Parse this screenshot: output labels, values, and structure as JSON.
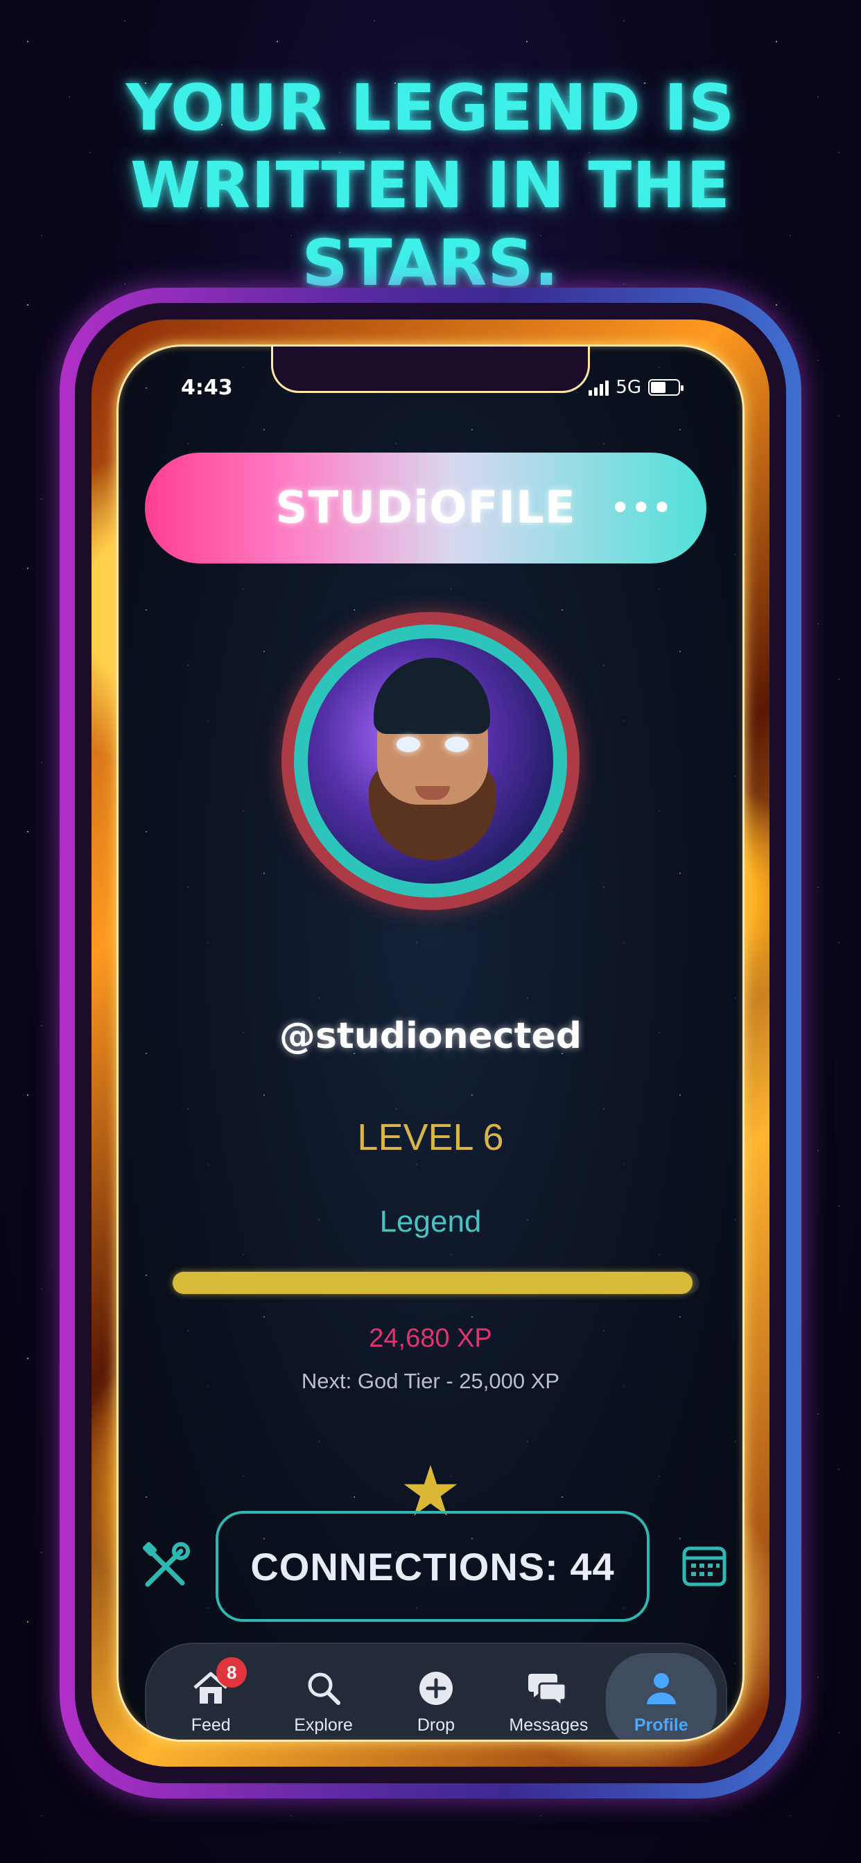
{
  "headline": "YOUR LEGEND IS WRITTEN IN THE STARS.",
  "status_bar": {
    "time": "4:43",
    "network": "5G"
  },
  "header": {
    "title": "STUDiOFILE",
    "more_label": "•••"
  },
  "profile": {
    "username": "@studionected",
    "level": "LEVEL 6",
    "rank": "Legend",
    "xp": "24,680 XP",
    "next_tier": "Next: God Tier - 25,000 XP",
    "xp_progress": 0.987,
    "connections": "CONNECTIONS: 44"
  },
  "tabs": [
    {
      "label": "Feed",
      "icon": "home-icon",
      "badge": "8",
      "active": false
    },
    {
      "label": "Explore",
      "icon": "search-icon",
      "active": false
    },
    {
      "label": "Drop",
      "icon": "plus-circle-icon",
      "active": false
    },
    {
      "label": "Messages",
      "icon": "chat-bubbles-icon",
      "active": false
    },
    {
      "label": "Profile",
      "icon": "person-icon",
      "active": true
    }
  ],
  "colors": {
    "headline": "#3ff0e8",
    "level": "#d8b44a",
    "rank": "#47c4c0",
    "xp": "#e0346f",
    "xp_bar": "#d8bb3a",
    "active_tab": "#4aa6ff",
    "badge": "#e0353d"
  }
}
